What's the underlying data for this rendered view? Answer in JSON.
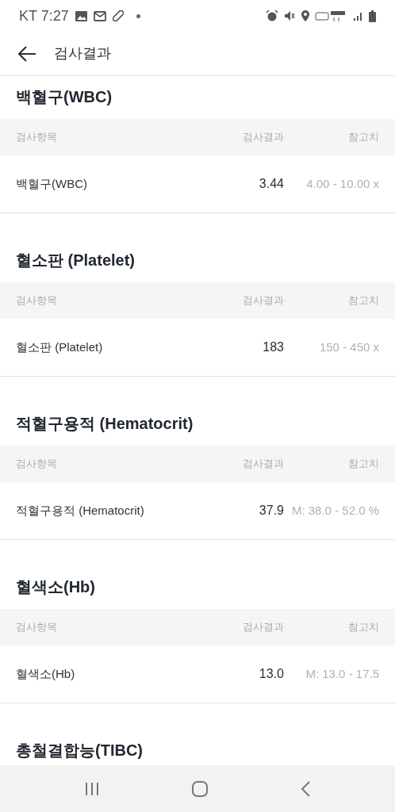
{
  "status_bar": {
    "carrier_time": "KT 7:27"
  },
  "app_bar": {
    "title": "검사결과"
  },
  "sections": [
    {
      "title": "백혈구(WBC)",
      "columns": [
        "검사항목",
        "검사결과",
        "참고치"
      ],
      "rows": [
        {
          "item": "백혈구(WBC)",
          "result": "3.44",
          "reference": "4.00 - 10.00 x"
        }
      ]
    },
    {
      "title": "혈소판 (Platelet)",
      "columns": [
        "검사항목",
        "검사결과",
        "참고치"
      ],
      "rows": [
        {
          "item": "혈소판 (Platelet)",
          "result": "183",
          "reference": "150 - 450 x"
        }
      ]
    },
    {
      "title": "적혈구용적 (Hematocrit)",
      "columns": [
        "검사항목",
        "검사결과",
        "참고치"
      ],
      "rows": [
        {
          "item": "적혈구용적 (Hematocrit)",
          "result": "37.9",
          "reference": "M: 38.0 - 52.0 %"
        }
      ]
    },
    {
      "title": "혈색소(Hb)",
      "columns": [
        "검사항목",
        "검사결과",
        "참고치"
      ],
      "rows": [
        {
          "item": "혈색소(Hb)",
          "result": "13.0",
          "reference": "M: 13.0 - 17.5"
        }
      ]
    },
    {
      "title": "총철결합능(TIBC)"
    }
  ]
}
